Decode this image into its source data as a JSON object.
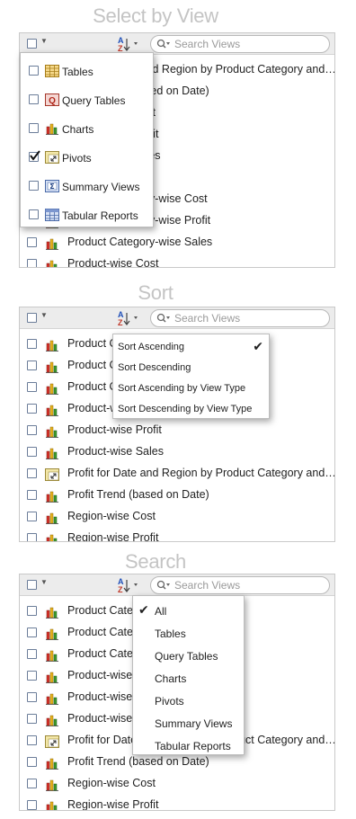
{
  "sections": {
    "select": {
      "title": "Select by View"
    },
    "sort": {
      "title": "Sort"
    },
    "search": {
      "title": "Search"
    }
  },
  "toolbar": {
    "search_placeholder": "Search Views",
    "sort_glyph_top": "A",
    "sort_glyph_bottom": "Z"
  },
  "select_panel": {
    "rows": [
      {
        "label": "Profit for Date and Region by Product Category and…",
        "icon": "pivot-icon"
      },
      {
        "label": "Profit Trend (based on Date)",
        "icon": "chart-icon"
      },
      {
        "label": "Region-wise Cost",
        "icon": "chart-icon"
      },
      {
        "label": "Region-wise Profit",
        "icon": "chart-icon"
      },
      {
        "label": "Region-wise Sales",
        "icon": "chart-icon"
      },
      {
        "label": "",
        "icon": "chart-icon"
      },
      {
        "label": "Product Category-wise Cost",
        "icon": "chart-icon"
      },
      {
        "label": "Product Category-wise Profit",
        "icon": "chart-icon"
      },
      {
        "label": "Product Category-wise Sales",
        "icon": "chart-icon"
      },
      {
        "label": "Product-wise Cost",
        "icon": "chart-icon"
      }
    ],
    "menu": [
      {
        "label": "Tables",
        "icon": "table-icon",
        "checked": false
      },
      {
        "label": "Query Tables",
        "icon": "query-table-icon",
        "checked": false
      },
      {
        "label": "Charts",
        "icon": "chart-icon",
        "checked": false
      },
      {
        "label": "Pivots",
        "icon": "pivot-icon",
        "checked": true
      },
      {
        "label": "Summary Views",
        "icon": "summary-view-icon",
        "checked": false
      },
      {
        "label": "Tabular Reports",
        "icon": "tabular-report-icon",
        "checked": false
      }
    ]
  },
  "sort_panel": {
    "rows": [
      {
        "label": "Product Category-wise Cost",
        "icon": "chart-icon"
      },
      {
        "label": "Product Category-wise Profit",
        "icon": "chart-icon"
      },
      {
        "label": "Product Category-wise Sales",
        "icon": "chart-icon"
      },
      {
        "label": "Product-wise Cost",
        "icon": "chart-icon"
      },
      {
        "label": "Product-wise Profit",
        "icon": "chart-icon"
      },
      {
        "label": "Product-wise Sales",
        "icon": "chart-icon"
      },
      {
        "label": "Profit for Date and Region by Product Category and…",
        "icon": "pivot-icon"
      },
      {
        "label": "Profit Trend (based on Date)",
        "icon": "chart-icon"
      },
      {
        "label": "Region-wise Cost",
        "icon": "chart-icon"
      },
      {
        "label": "Region-wise Profit",
        "icon": "chart-icon"
      }
    ],
    "menu": [
      {
        "label": "Sort Ascending",
        "checked": true
      },
      {
        "label": "Sort Descending",
        "checked": false
      },
      {
        "label": "Sort Ascending by View Type",
        "checked": false
      },
      {
        "label": "Sort Descending by View Type",
        "checked": false
      }
    ]
  },
  "search_panel": {
    "rows": [
      {
        "label": "Product Category-wise Cost",
        "icon": "chart-icon"
      },
      {
        "label": "Product Category-wise Profit",
        "icon": "chart-icon"
      },
      {
        "label": "Product Category-wise Sales",
        "icon": "chart-icon"
      },
      {
        "label": "Product-wise Cost",
        "icon": "chart-icon"
      },
      {
        "label": "Product-wise Profit",
        "icon": "chart-icon"
      },
      {
        "label": "Product-wise Sales",
        "icon": "chart-icon"
      },
      {
        "label": "Profit for Date and Region by Product Category and…",
        "icon": "pivot-icon"
      },
      {
        "label": "Profit Trend (based on Date)",
        "icon": "chart-icon"
      },
      {
        "label": "Region-wise Cost",
        "icon": "chart-icon"
      },
      {
        "label": "Region-wise Profit",
        "icon": "chart-icon"
      }
    ],
    "menu": [
      {
        "label": "All",
        "checked": true
      },
      {
        "label": "Tables",
        "checked": false
      },
      {
        "label": "Query Tables",
        "checked": false
      },
      {
        "label": "Charts",
        "checked": false
      },
      {
        "label": "Pivots",
        "checked": false
      },
      {
        "label": "Summary Views",
        "checked": false
      },
      {
        "label": "Tabular Reports",
        "checked": false
      }
    ]
  },
  "colors": {
    "title": "#c4c4c4",
    "toolbar_bg": "#ececec",
    "checkbox_border": "#6b7d99",
    "bar_red": "#d6322a",
    "bar_yellow": "#e8b21c",
    "bar_green": "#3f9a2f"
  }
}
